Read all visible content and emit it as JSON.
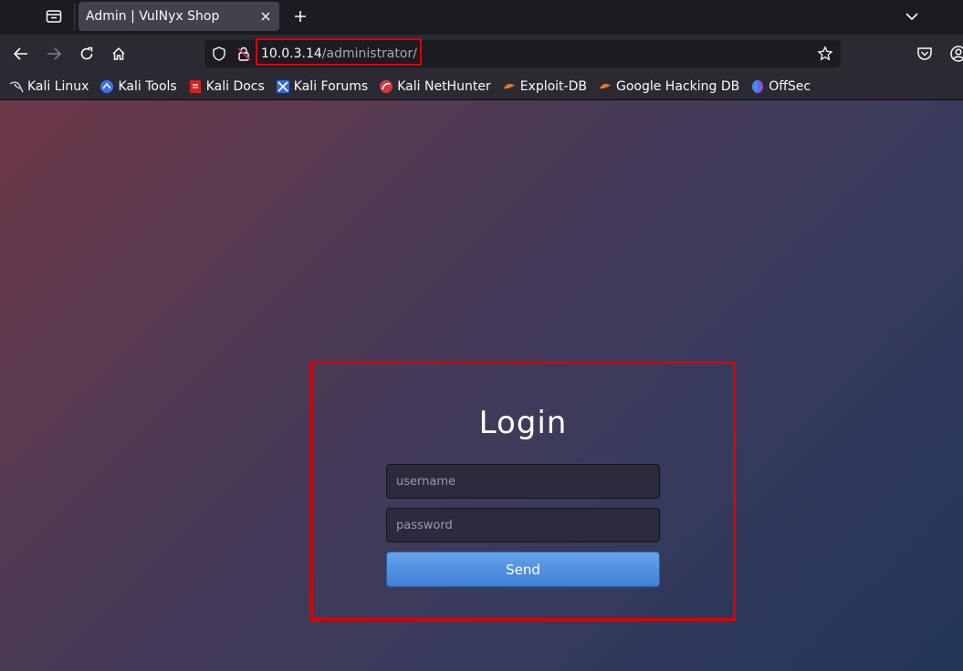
{
  "browser": {
    "tab": {
      "title": "Admin | VulNyx Shop"
    },
    "url": {
      "host": "10.0.3.14",
      "path": "/administrator/"
    },
    "bookmarks": [
      {
        "label": "Kali Linux",
        "icon": "kali-dragon-icon"
      },
      {
        "label": "Kali Tools",
        "icon": "kali-tools-icon"
      },
      {
        "label": "Kali Docs",
        "icon": "kali-docs-icon"
      },
      {
        "label": "Kali Forums",
        "icon": "kali-forums-icon"
      },
      {
        "label": "Kali NetHunter",
        "icon": "kali-nethunter-icon"
      },
      {
        "label": "Exploit-DB",
        "icon": "exploit-db-icon"
      },
      {
        "label": "Google Hacking DB",
        "icon": "ghdb-icon"
      },
      {
        "label": "OffSec",
        "icon": "offsec-icon"
      }
    ]
  },
  "login": {
    "title": "Login",
    "username_placeholder": "username",
    "password_placeholder": "password",
    "submit_label": "Send"
  },
  "colors": {
    "highlight": "#e00000",
    "button": "#4f8fe0",
    "chrome_dark": "#1c1b22",
    "chrome": "#2b2a33"
  }
}
